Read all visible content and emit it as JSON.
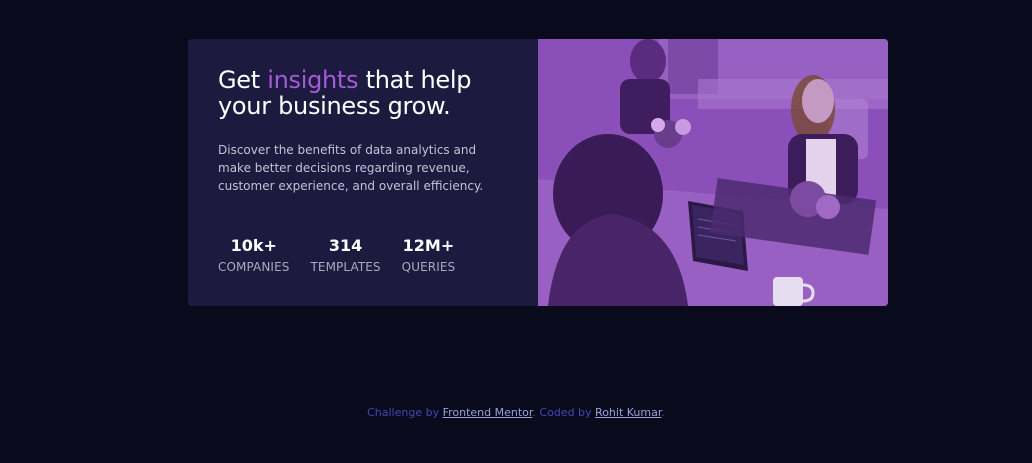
{
  "card": {
    "headline_pre": "Get",
    "headline_accent": "insights",
    "headline_post": "that help your business grow.",
    "description": "Discover the benefits of data analytics and make better decisions regarding revenue, customer experience, and overall efficiency.",
    "stats": [
      {
        "value": "10k+",
        "label": "COMPANIES"
      },
      {
        "value": "314",
        "label": "TEMPLATES"
      },
      {
        "value": "12M+",
        "label": "QUERIES"
      }
    ],
    "accent_color": "#a35bd8",
    "image_tint": "#8d52bb"
  },
  "footer": {
    "challenge_text": "Challenge by",
    "challenge_link": "Frontend Mentor",
    "coded_text": ". Coded by",
    "author_link": "Rohit Kumar",
    "end_text": "."
  }
}
